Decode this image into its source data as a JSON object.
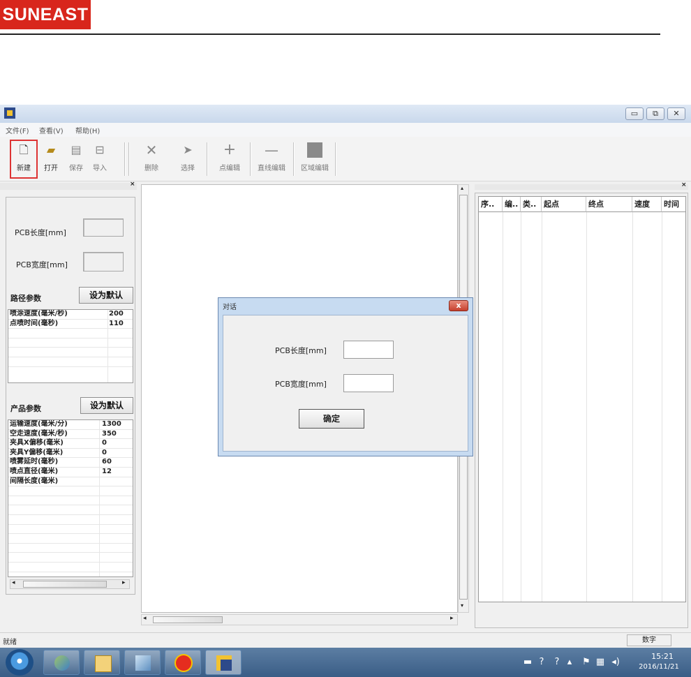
{
  "brand": {
    "logo_text": "SUNEAST"
  },
  "window": {
    "controls": {
      "minimize": "▭",
      "restore": "⧉",
      "close": "✕"
    }
  },
  "menu": [
    "文件(F)",
    "查看(V)",
    "帮助(H)"
  ],
  "toolbar": {
    "group1": [
      {
        "label": "新建",
        "icon": "new-file-icon"
      },
      {
        "label": "打开",
        "icon": "open-folder-icon"
      },
      {
        "label": "保存",
        "icon": "save-icon"
      },
      {
        "label": "导入",
        "icon": "import-icon"
      }
    ],
    "group2": [
      {
        "label": "删除",
        "icon": "delete-x-icon"
      },
      {
        "label": "选择",
        "icon": "cursor-arrow-icon"
      },
      {
        "label": "点编辑",
        "icon": "crosshair-icon"
      },
      {
        "label": "直线编辑",
        "icon": "line-icon"
      },
      {
        "label": "区域编辑",
        "icon": "area-square-icon"
      }
    ]
  },
  "left_panel": {
    "pcb_length_label": "PCB长度[mm]",
    "pcb_width_label": "PCB宽度[mm]",
    "path_title": "路径参数",
    "path_default_button": "设为默认",
    "path_params": [
      {
        "name": "喷涂速度(毫米/秒)",
        "value": "200"
      },
      {
        "name": "点喷时间(毫秒)",
        "value": "110"
      }
    ],
    "product_title": "产品参数",
    "product_default_button": "设为默认",
    "product_params": [
      {
        "name": "运输速度(毫米/分)",
        "value": "1300"
      },
      {
        "name": "空走速度(毫米/秒)",
        "value": "350"
      },
      {
        "name": "夹具X偏移(毫米)",
        "value": "0"
      },
      {
        "name": "夹具Y偏移(毫米)",
        "value": "0"
      },
      {
        "name": "喷雾延时(毫秒)",
        "value": "60"
      },
      {
        "name": "喷点直径(毫米)",
        "value": "12"
      },
      {
        "name": "间隔长度(毫米)",
        "value": ""
      }
    ]
  },
  "right_table": {
    "headers": [
      "序..",
      "编..",
      "类..",
      "起点",
      "终点",
      "速度",
      "时间"
    ]
  },
  "dialog": {
    "title": "对话",
    "close_label": "x",
    "pcb_length_label": "PCB长度[mm]",
    "pcb_width_label": "PCB宽度[mm]",
    "ok_button": "确定"
  },
  "statusbar": {
    "left_text": "就绪",
    "num_indicator": "数字"
  },
  "taskbar": {
    "clock_time": "15:21",
    "clock_date": "2016/11/21"
  },
  "colors": {
    "logo_red": "#d8261c",
    "highlight_red": "#dd3333",
    "dialog_frame": "#c7dbf1"
  }
}
